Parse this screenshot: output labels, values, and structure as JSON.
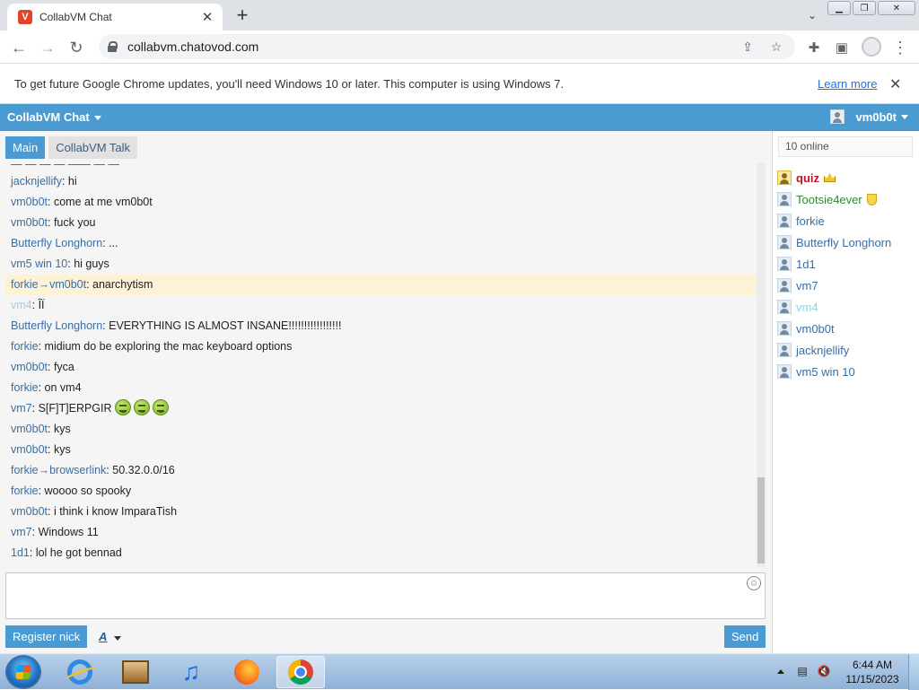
{
  "browser": {
    "tab_title": "CollabVM Chat",
    "favicon_letter": "V",
    "url": "collabvm.chatovod.com",
    "infobar_text": "To get future Google Chrome updates, you'll need Windows 10 or later. This computer is using Windows 7.",
    "infobar_link": "Learn more"
  },
  "app": {
    "name": "CollabVM Chat",
    "current_user": "vm0b0t",
    "tabs": [
      {
        "label": "Main",
        "active": true
      },
      {
        "label": "CollabVM Talk",
        "active": false
      }
    ],
    "cut_line": "—  — — — ——  —  — ",
    "messages": [
      {
        "nick": "jacknjellify",
        "text": "hi"
      },
      {
        "nick": "vm0b0t",
        "text": "come at me vm0b0t"
      },
      {
        "nick": "vm0b0t",
        "text": "fuck you"
      },
      {
        "nick": "Butterfly Longhorn",
        "text": "..."
      },
      {
        "nick": "vm5 win 10",
        "text": "hi guys"
      },
      {
        "nick": "forkie",
        "to": "vm0b0t",
        "text": "anarchytism",
        "highlight": true
      },
      {
        "nick": "vm4",
        "text": "ÎÏ",
        "faint": true
      },
      {
        "nick": "Butterfly Longhorn",
        "text": "EVERYTHING IS ALMOST INSANE!!!!!!!!!!!!!!!!!"
      },
      {
        "nick": "forkie",
        "text": "midium do be exploring the mac keyboard options"
      },
      {
        "nick": "vm0b0t",
        "text": "fyca"
      },
      {
        "nick": "forkie",
        "text": "on vm4"
      },
      {
        "nick": "vm7",
        "text": "S[F]T]ERPGIR",
        "emojis": 3
      },
      {
        "nick": "vm0b0t",
        "text": "kys"
      },
      {
        "nick": "vm0b0t",
        "text": "kys"
      },
      {
        "nick": "forkie",
        "to": "browserlink",
        "text": "50.32.0.0/16"
      },
      {
        "nick": "forkie",
        "text": "woooo so spooky"
      },
      {
        "nick": "vm0b0t",
        "text": "i think i know ImparaTish"
      },
      {
        "nick": "vm7",
        "text": "Windows 11"
      },
      {
        "nick": "1d1",
        "text": "lol he got bennad"
      }
    ],
    "input_placeholder": "",
    "register_label": "Register nick",
    "font_label": "A",
    "send_label": "Send",
    "online_count": "10 online",
    "users": [
      {
        "name": "quiz",
        "role": "admin",
        "badge": "crown-icon"
      },
      {
        "name": "Tootsie4ever",
        "role": "mod",
        "badge": "shield-icon"
      },
      {
        "name": "forkie",
        "role": "user"
      },
      {
        "name": "Butterfly Longhorn",
        "role": "user"
      },
      {
        "name": "1d1",
        "role": "user"
      },
      {
        "name": "vm7",
        "role": "user"
      },
      {
        "name": "vm4",
        "role": "faint"
      },
      {
        "name": "vm0b0t",
        "role": "user"
      },
      {
        "name": "jacknjellify",
        "role": "user"
      },
      {
        "name": "vm5 win 10",
        "role": "user"
      }
    ]
  },
  "taskbar": {
    "apps": [
      "internet-explorer-icon",
      "media-center-icon",
      "itunes-icon",
      "firefox-icon",
      "chrome-icon"
    ],
    "active_app": "chrome-icon",
    "time": "6:44 AM",
    "date": "11/15/2023"
  },
  "colors": {
    "accent": "#4a9bd2",
    "nick": "#3b6ea0",
    "admin": "#c0142a",
    "mod": "#2c8a2a",
    "highlight": "#fdf1d6"
  }
}
